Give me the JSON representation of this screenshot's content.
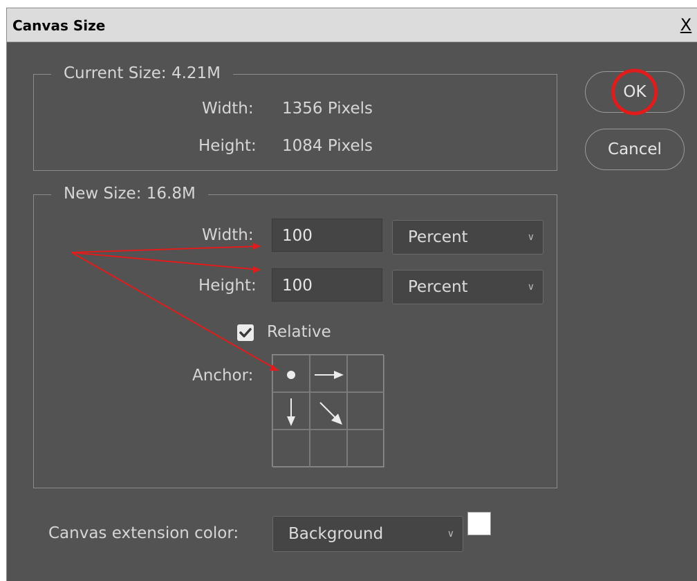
{
  "window": {
    "title": "Canvas Size",
    "close_label": "X"
  },
  "current_size": {
    "legend": "Current Size: 4.21M",
    "width_label": "Width:",
    "width_value": "1356 Pixels",
    "height_label": "Height:",
    "height_value": "1084 Pixels"
  },
  "new_size": {
    "legend": "New Size: 16.8M",
    "width_label": "Width:",
    "width_value": "100",
    "width_unit": "Percent",
    "height_label": "Height:",
    "height_value": "100",
    "height_unit": "Percent",
    "relative_label": "Relative",
    "relative_checked": true,
    "anchor_label": "Anchor:"
  },
  "buttons": {
    "ok": "OK",
    "cancel": "Cancel"
  },
  "extension": {
    "label": "Canvas extension color:",
    "value": "Background",
    "swatch_color": "#ffffff"
  },
  "annotations": {
    "arrow_color": "#e01c1c",
    "circle_color": "#e01c1c"
  },
  "icons": {
    "anchor_center": "dot-icon",
    "anchor_right": "arrow-right-icon",
    "anchor_down": "arrow-down-icon",
    "anchor_diag": "arrow-down-right-icon",
    "chevron": "chevron-down-icon"
  }
}
